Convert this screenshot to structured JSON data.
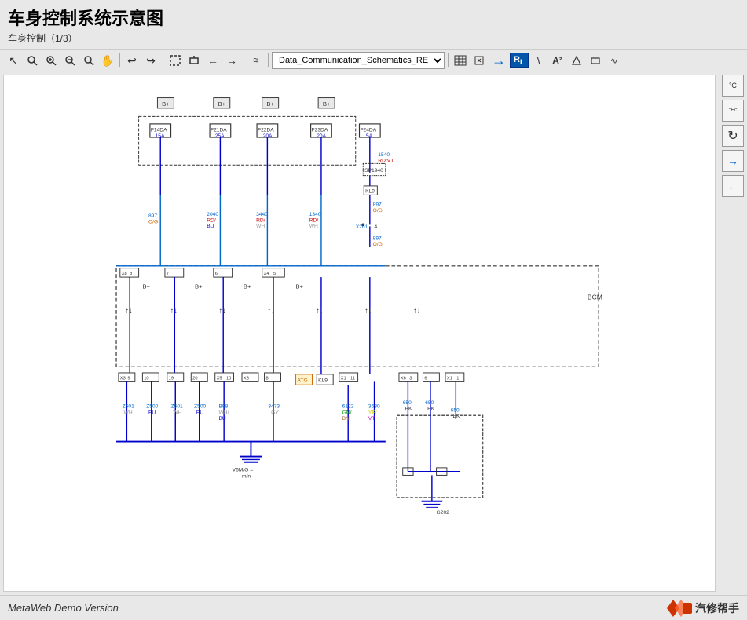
{
  "app": {
    "main_title": "车身控制系统示意图",
    "subtitle": "车身控制（1/3）",
    "footer_version": "MetaWeb Demo Version",
    "footer_brand": "汽修帮手"
  },
  "toolbar": {
    "dropdown_value": "Data_Communication_Schematics_REF",
    "dropdown_options": [
      "Data_Communication_Schematics_REF"
    ],
    "buttons": [
      {
        "name": "cursor",
        "icon": "↖",
        "label": "Cursor"
      },
      {
        "name": "zoom-area",
        "icon": "🔍",
        "label": "Zoom Area"
      },
      {
        "name": "zoom-in",
        "icon": "⊕",
        "label": "Zoom In"
      },
      {
        "name": "zoom-out",
        "icon": "⊖",
        "label": "Zoom Out"
      },
      {
        "name": "search",
        "icon": "🔎",
        "label": "Search"
      },
      {
        "name": "pan",
        "icon": "✋",
        "label": "Pan"
      },
      {
        "name": "undo",
        "icon": "↩",
        "label": "Undo"
      },
      {
        "name": "redo",
        "icon": "↪",
        "label": "Redo"
      },
      {
        "name": "fit",
        "icon": "⊡",
        "label": "Fit"
      },
      {
        "name": "zoom-window",
        "icon": "⊞",
        "label": "Zoom Window"
      },
      {
        "name": "nav-left",
        "icon": "←",
        "label": "Previous"
      },
      {
        "name": "nav-right",
        "icon": "→",
        "label": "Next"
      },
      {
        "name": "signal",
        "icon": "≋",
        "label": "Signal"
      }
    ]
  },
  "right_panel": {
    "buttons": [
      {
        "name": "temp-celsius",
        "icon": "°C",
        "label": "Temperature C"
      },
      {
        "name": "temp-ec",
        "icon": "°EC",
        "label": "Temperature EC"
      },
      {
        "name": "rotate",
        "icon": "↻",
        "label": "Rotate"
      },
      {
        "name": "arrow-right",
        "icon": "→",
        "label": "Arrow Right"
      },
      {
        "name": "arrow-left",
        "icon": "←",
        "label": "Arrow Left"
      }
    ]
  }
}
